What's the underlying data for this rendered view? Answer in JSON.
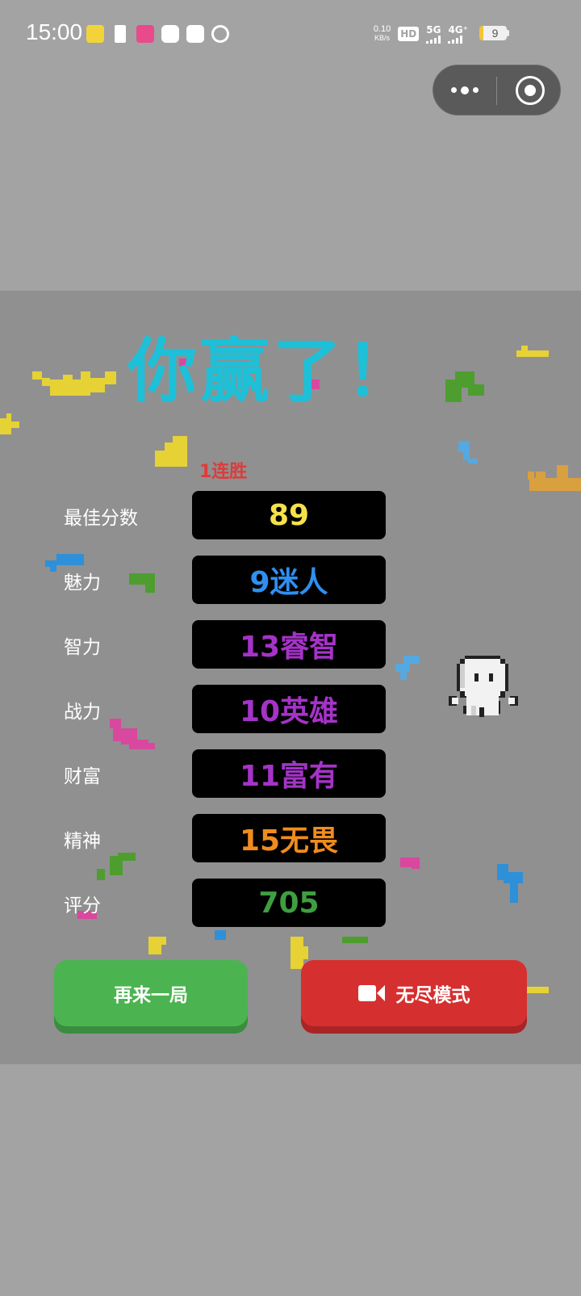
{
  "status_bar": {
    "time": "15:00",
    "netspeed_value": "0.10",
    "netspeed_unit": "KB/s",
    "hd": "HD",
    "sim1": "5G",
    "sim2": "4G⁺",
    "battery": "9"
  },
  "game": {
    "title": "你赢了！",
    "streak": "1连胜",
    "stats": [
      {
        "label": "最佳分数",
        "value": "89",
        "color": "#f5e24a"
      },
      {
        "label": "魅力",
        "value": "9迷人",
        "color": "#2f8ff0"
      },
      {
        "label": "智力",
        "value": "13睿智",
        "color": "#a533c8"
      },
      {
        "label": "战力",
        "value": "10英雄",
        "color": "#a533c8"
      },
      {
        "label": "财富",
        "value": "11富有",
        "color": "#a533c8"
      },
      {
        "label": "精神",
        "value": "15无畏",
        "color": "#f08c1e"
      },
      {
        "label": "评分",
        "value": "705",
        "color": "#3f9e3f"
      }
    ],
    "buttons": {
      "again": "再来一局",
      "endless": "无尽模式"
    }
  },
  "colors": {
    "title": "#1ec0d8",
    "streak": "#e03a3a",
    "again_button": "#4bb450",
    "endless_button": "#d62f2f"
  }
}
